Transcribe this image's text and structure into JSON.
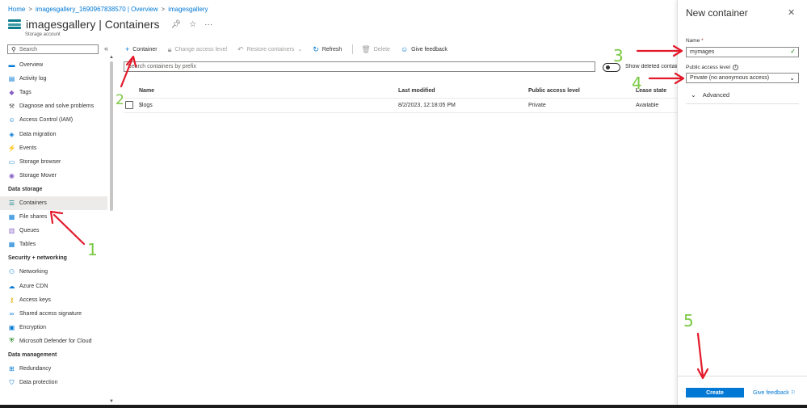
{
  "breadcrumb": [
    "Home",
    "imagesgallery_1690967838570 | Overview",
    "imagesgallery"
  ],
  "header": {
    "resource_name": "imagesgallery",
    "page_name": "Containers",
    "separator": " | ",
    "subtitle": "Storage account",
    "pin_icon": "pin-icon",
    "star_icon": "star-icon",
    "more": "···"
  },
  "sidebar": {
    "search_placeholder": "Search",
    "collapse": "«",
    "items": [
      {
        "label": "Overview",
        "icon": "overview-icon",
        "glyph": "▬",
        "color": "#0078d4"
      },
      {
        "label": "Activity log",
        "icon": "activity-log-icon",
        "glyph": "▤",
        "color": "#0078d4"
      },
      {
        "label": "Tags",
        "icon": "tag-icon",
        "glyph": "◆",
        "color": "#8661c5"
      },
      {
        "label": "Diagnose and solve problems",
        "icon": "wrench-icon",
        "glyph": "⚒",
        "color": "#605e5c"
      },
      {
        "label": "Access Control (IAM)",
        "icon": "people-icon",
        "glyph": "☺",
        "color": "#0078d4"
      },
      {
        "label": "Data migration",
        "icon": "migration-icon",
        "glyph": "◈",
        "color": "#0078d4"
      },
      {
        "label": "Events",
        "icon": "lightning-icon",
        "glyph": "⚡",
        "color": "#f2c811"
      },
      {
        "label": "Storage browser",
        "icon": "storage-browser-icon",
        "glyph": "▭",
        "color": "#0078d4"
      },
      {
        "label": "Storage Mover",
        "icon": "storage-mover-icon",
        "glyph": "◉",
        "color": "#8661c5"
      }
    ],
    "section_data_storage": "Data storage",
    "data_storage": [
      {
        "label": "Containers",
        "icon": "containers-icon",
        "glyph": "☰",
        "color": "#0a7d8c"
      },
      {
        "label": "File shares",
        "icon": "file-shares-icon",
        "glyph": "▦",
        "color": "#0078d4"
      },
      {
        "label": "Queues",
        "icon": "queues-icon",
        "glyph": "▥",
        "color": "#8661c5"
      },
      {
        "label": "Tables",
        "icon": "tables-icon",
        "glyph": "▦",
        "color": "#0078d4"
      }
    ],
    "section_security": "Security + networking",
    "security": [
      {
        "label": "Networking",
        "icon": "networking-icon",
        "glyph": "⚇",
        "color": "#0078d4"
      },
      {
        "label": "Azure CDN",
        "icon": "cloud-icon",
        "glyph": "☁",
        "color": "#0078d4"
      },
      {
        "label": "Access keys",
        "icon": "key-icon",
        "glyph": "⚷",
        "color": "#f2c811"
      },
      {
        "label": "Shared access signature",
        "icon": "link-icon",
        "glyph": "∞",
        "color": "#0078d4"
      },
      {
        "label": "Encryption",
        "icon": "lock-icon",
        "glyph": "▣",
        "color": "#0078d4"
      },
      {
        "label": "Microsoft Defender for Cloud",
        "icon": "shield-icon",
        "glyph": "⛨",
        "color": "#107c10"
      }
    ],
    "section_data_management": "Data management",
    "data_management": [
      {
        "label": "Redundancy",
        "icon": "redundancy-icon",
        "glyph": "⊞",
        "color": "#0078d4"
      },
      {
        "label": "Data protection",
        "icon": "data-protection-icon",
        "glyph": "⛉",
        "color": "#0078d4"
      }
    ]
  },
  "toolbar": {
    "add_container": "Container",
    "change_access_level": "Change access level",
    "restore_containers": "Restore containers",
    "refresh": "Refresh",
    "delete": "Delete",
    "give_feedback": "Give feedback"
  },
  "filter": {
    "placeholder": "Search containers by prefix",
    "show_deleted": "Show deleted containers"
  },
  "table": {
    "columns": [
      "Name",
      "Last modified",
      "Public access level",
      "Lease state"
    ],
    "rows": [
      {
        "name": "$logs",
        "last_modified": "8/2/2023, 12:18:05 PM",
        "access": "Private",
        "lease": "Available"
      }
    ]
  },
  "panel": {
    "title": "New container",
    "close": "✕",
    "name_label": "Name",
    "required_mark": "*",
    "name_value": "mymages",
    "access_label": "Public access level",
    "access_value": "Private (no anonymous access)",
    "advanced": "Advanced",
    "create": "Create",
    "give_feedback": "Give feedback"
  },
  "annotations": {
    "color_arrow": "#e3192a",
    "color_number": "#7ac943",
    "numbers": [
      "1",
      "2",
      "3",
      "4",
      "5"
    ]
  }
}
